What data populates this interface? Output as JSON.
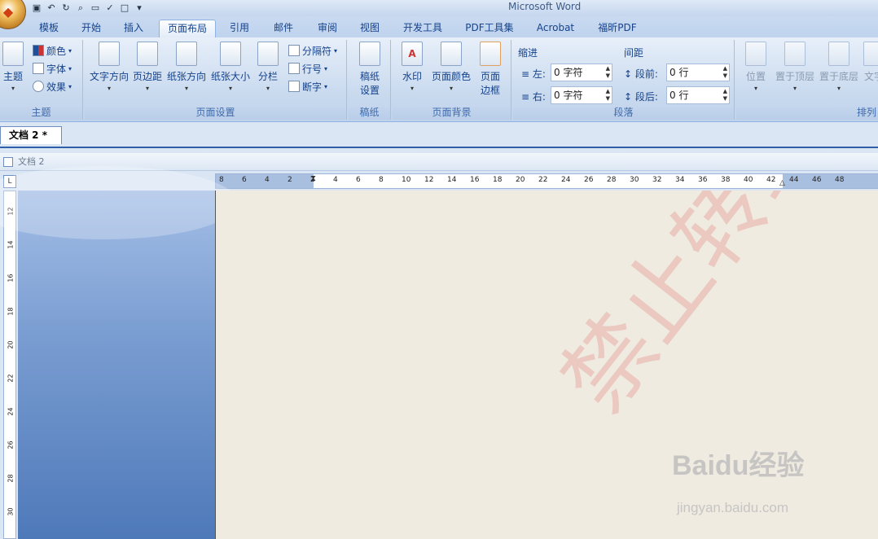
{
  "app": {
    "title": "Microsoft Word"
  },
  "tabs": [
    "模板",
    "开始",
    "插入",
    "页面布局",
    "引用",
    "邮件",
    "审阅",
    "视图",
    "开发工具",
    "PDF工具集",
    "Acrobat",
    "福昕PDF"
  ],
  "active_tab": "页面布局",
  "groups": {
    "theme": {
      "label": "主题",
      "big": "主题",
      "small": [
        "颜色",
        "字体",
        "效果"
      ]
    },
    "page_setup": {
      "label": "页面设置",
      "big": [
        "文字方向",
        "页边距",
        "纸张方向",
        "纸张大小",
        "分栏"
      ],
      "small": [
        "分隔符",
        "行号",
        "断字"
      ]
    },
    "draft": {
      "label": "稿纸",
      "big": [
        "稿纸",
        "设置"
      ]
    },
    "page_bg": {
      "label": "页面背景",
      "big": [
        "水印",
        "页面颜色",
        "页面",
        "边框"
      ]
    },
    "paragraph": {
      "label": "段落",
      "indent": "缩进",
      "spacing": "间距",
      "left": "左:",
      "right": "右:",
      "before": "段前:",
      "after": "段后:",
      "left_val": "0 字符",
      "right_val": "0 字符",
      "before_val": "0 行",
      "after_val": "0 行"
    },
    "arrange": {
      "label": "排列",
      "big": [
        "位置",
        "置于顶层",
        "置于底层",
        "文字"
      ]
    }
  },
  "doc_tab": "文档 2 *",
  "inner_title": "文档 2",
  "ruler_corner": "L",
  "hruler_ticks": [
    "8",
    "6",
    "4",
    "2",
    "2",
    "4",
    "6",
    "8",
    "10",
    "12",
    "14",
    "16",
    "18",
    "20",
    "22",
    "24",
    "26",
    "28",
    "30",
    "32",
    "34",
    "36",
    "38",
    "40",
    "42",
    "44",
    "46",
    "48"
  ],
  "vruler_ticks": [
    "12",
    "14",
    "16",
    "18",
    "20",
    "22",
    "24",
    "26",
    "28",
    "30"
  ],
  "watermark": "禁止转载",
  "baidu": {
    "logo": "Baidu经验",
    "url": "jingyan.baidu.com"
  }
}
